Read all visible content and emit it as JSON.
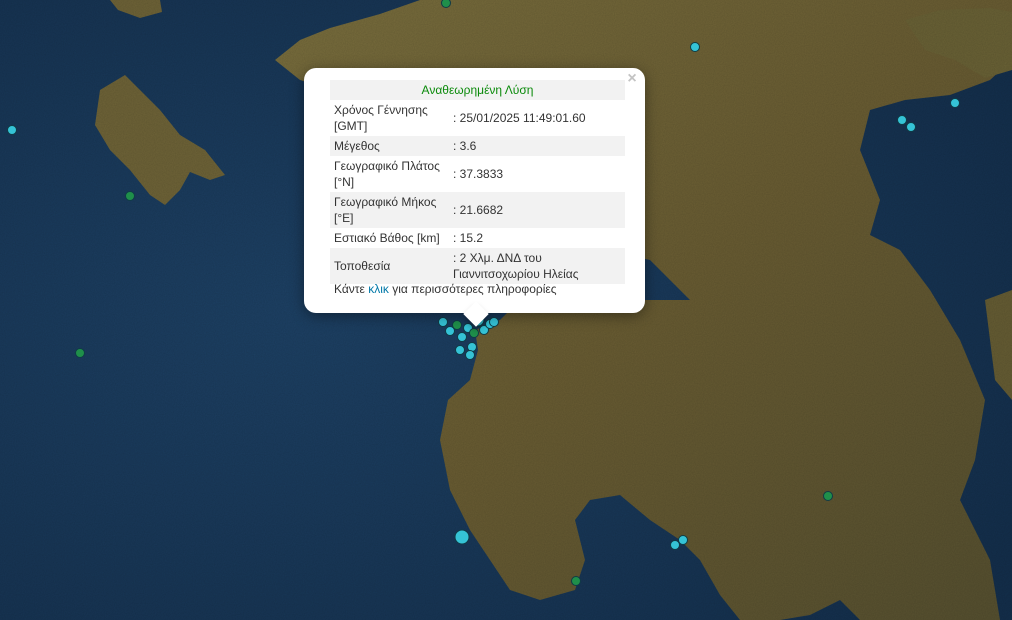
{
  "popup": {
    "title": "Αναθεωρημένη Λύση",
    "close_symbol": "×",
    "rows": [
      {
        "label": "Χρόνος Γέννησης [GMT]",
        "value": ": 25/01/2025 11:49:01.60"
      },
      {
        "label": "Μέγεθος",
        "value": ": 3.6"
      },
      {
        "label": "Γεωγραφικό Πλάτος [°N]",
        "value": ": 37.3833"
      },
      {
        "label": "Γεωγραφικό Μήκος [°E]",
        "value": ": 21.6682"
      },
      {
        "label": "Εστιακό Βάθος [km]",
        "value": ": 15.2"
      },
      {
        "label": "Τοποθεσία",
        "value": ": 2 Χλμ. ΔΝΔ του Γιαννιτσοχωρίου Ηλείας"
      }
    ],
    "more_prefix": "Κάντε ",
    "more_link": "κλικ",
    "more_suffix": " για περισσότερες πληροφορίες"
  },
  "marker_colors": {
    "recent": "#35c3d6",
    "older": "#1f8f4a",
    "outline": "#0f3c46",
    "sea": "#1a3a5a",
    "land": "#6b6236",
    "title_green": "#0b8a0b",
    "link_blue": "#0078a8"
  },
  "markers": [
    {
      "name": "quake-marker",
      "type": "recent"
    },
    {
      "name": "quake-marker",
      "type": "recent"
    },
    {
      "name": "quake-marker",
      "type": "recent"
    },
    {
      "name": "quake-marker",
      "type": "recent"
    },
    {
      "name": "quake-marker",
      "type": "recent"
    },
    {
      "name": "quake-marker",
      "type": "recent"
    },
    {
      "name": "quake-marker",
      "type": "recent"
    },
    {
      "name": "quake-marker",
      "type": "older"
    },
    {
      "name": "quake-marker",
      "type": "older"
    },
    {
      "name": "quake-marker",
      "type": "older"
    },
    {
      "name": "quake-marker",
      "type": "older"
    },
    {
      "name": "quake-marker",
      "type": "older"
    },
    {
      "name": "quake-marker",
      "type": "older"
    }
  ]
}
